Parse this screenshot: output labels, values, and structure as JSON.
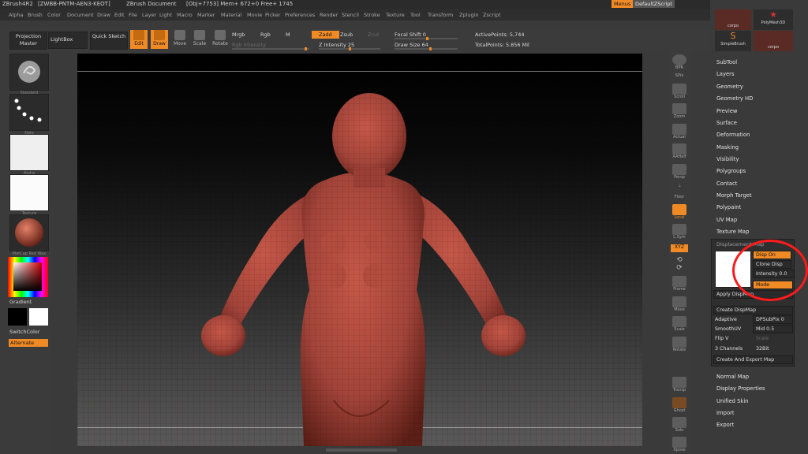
{
  "titlebar": {
    "app": "ZBrush4R2",
    "serial": "[ZWBB-PNTM-AEN3-KEOT]",
    "doc": "ZBrush Document",
    "stats": "[Obj+7753] Mem+ 672+0 Free+ 1745",
    "menus_btn": "Menus",
    "script_btn": "DefaultZScript"
  },
  "menubar": [
    "Alpha",
    "Brush",
    "Color",
    "Document",
    "Draw",
    "Edit",
    "File",
    "Layer",
    "Light",
    "Macro",
    "Marker",
    "Material",
    "Movie",
    "Picker",
    "Preferences",
    "Render",
    "Stencil",
    "Stroke",
    "Texture",
    "Tool",
    "Transform",
    "Zplugin",
    "Zscript"
  ],
  "toolbar": {
    "projection_master": "Projection Master",
    "lightbox": "LightBox",
    "quick_sketch": "Quick Sketch",
    "edit": "Edit",
    "draw": "Draw",
    "move": "Move",
    "scale": "Scale",
    "rotate": "Rotate",
    "mrgb": "Mrgb",
    "rgb": "Rgb",
    "m": "M",
    "zadd": "Zadd",
    "zsub": "Zsub",
    "zcut": "Zcut",
    "rgb_intensity": "Rgb Intensity",
    "z_intensity": "Z Intensity 25",
    "focal_shift": "Focal Shift 0",
    "draw_size": "Draw Size 64",
    "active_points": "ActivePoints: 5,744",
    "total_points": "TotalPoints: 5.856 Mil"
  },
  "leftshelf": {
    "thumbs": [
      "Standard",
      "Dots",
      "Alpha",
      "Texture",
      "MatCap Red Wax"
    ],
    "gradient": "Gradient",
    "switch_color": "SwitchColor",
    "alternate": "Alternate"
  },
  "rightshelf": [
    "BPR",
    "SPix",
    "Scroll",
    "Zoom",
    "Actual",
    "AAHalf",
    "Persp",
    "Floor",
    "Local",
    "L.Sym",
    "XYZ",
    "Frame",
    "Move",
    "Scale",
    "Rotate",
    "Transp",
    "Ghost",
    "Solo",
    "Xpose"
  ],
  "palette": {
    "tool_thumbs": [
      "corpo",
      "PolyMesh3D",
      "SimpleBrush",
      "corpo"
    ],
    "items": [
      "SubTool",
      "Layers",
      "Geometry",
      "Geometry HD",
      "Preview",
      "Surface",
      "Deformation",
      "Masking",
      "Visibility",
      "Polygroups",
      "Contact",
      "Morph Target",
      "Polypaint",
      "UV Map",
      "Texture Map"
    ],
    "displacement": {
      "header": "Displacement Map",
      "disp_on": "Disp On",
      "clone_disp": "Clone Disp",
      "intensity": "Intensity 0.0",
      "mode": "Mode",
      "apply": "Apply DispMap",
      "create": "Create DispMap",
      "adaptive": "Adaptive",
      "dpsubpix": "DPSubPix 0",
      "smoothuv": "SmoothUV",
      "mid": "Mid 0.5",
      "flipv": "Flip V",
      "scale": "Scale",
      "channels": "3 Channels",
      "bits": "32Bit",
      "export": "Create And Export Map"
    },
    "items_after": [
      "Normal Map",
      "Display Properties",
      "Unified Skin",
      "Import",
      "Export"
    ]
  },
  "colors": {
    "accent": "#f08a24",
    "model": "#a9473a",
    "annotation": "#ff1b1b"
  }
}
